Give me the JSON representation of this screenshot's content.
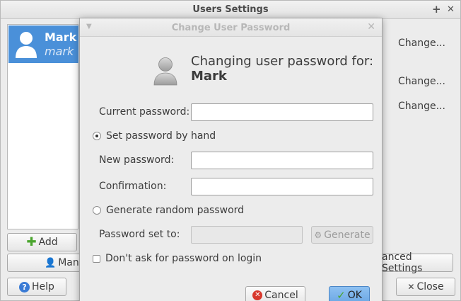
{
  "main_window": {
    "title": "Users Settings",
    "title_buttons": [
      "+",
      "✕"
    ],
    "users": [
      {
        "username": "Mark",
        "full_name": "mark"
      }
    ],
    "change_links": [
      "Change...",
      "Change...",
      "Change..."
    ],
    "buttons": {
      "add": "Add",
      "manage": "Mana",
      "advanced": "anced Settings",
      "help": "Help",
      "close": "Close"
    }
  },
  "dialog": {
    "title": "Change User Password",
    "heading_line1": "Changing user password for:",
    "heading_user": "Mark",
    "current_password_label": "Current password:",
    "current_password_value": "",
    "radio_set_by_hand": "Set password by hand",
    "radio_set_by_hand_selected": true,
    "new_password_label": "New password:",
    "new_password_value": "",
    "confirmation_label": "Confirmation:",
    "confirmation_value": "",
    "radio_generate": "Generate random password",
    "radio_generate_selected": false,
    "password_set_to_label": "Password set to:",
    "password_set_to_value": "",
    "generate_button": "Generate",
    "dont_ask_label": "Don't ask for password on login",
    "dont_ask_checked": false,
    "cancel_button": "Cancel",
    "ok_button": "OK"
  },
  "colors": {
    "selection": "#4a90d9",
    "ok_button": "#7bb3ec",
    "cancel_icon": "#d8382c",
    "ok_icon": "#4aa52e",
    "add_icon": "#4aa52e",
    "help_icon": "#3a7bd5"
  },
  "icons": {
    "user_avatar": "user-avatar-icon",
    "add": "plus-icon",
    "manage": "users-icon",
    "help": "help-icon",
    "close": "close-icon",
    "cancel": "cancel-icon",
    "ok": "check-icon",
    "generate": "generate-icon"
  }
}
